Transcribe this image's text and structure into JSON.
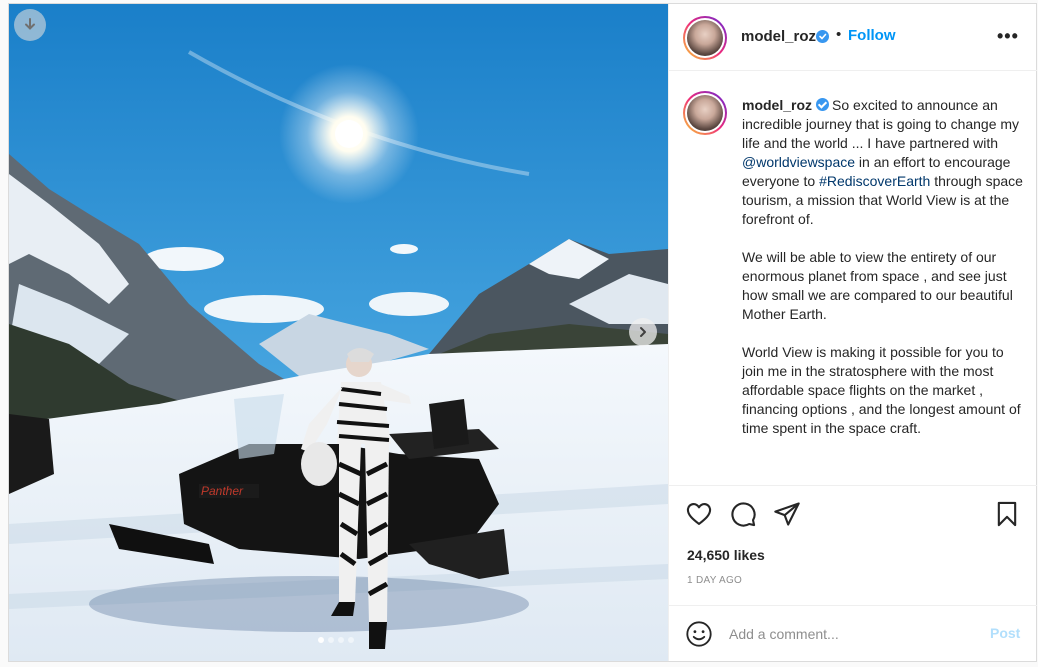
{
  "post": {
    "username": "model_roz",
    "verified": true,
    "follow_label": "Follow",
    "bullet": "•",
    "more_label": "•••",
    "caption": {
      "username": "model_roz",
      "p1_a": "So excited to announce an incredible journey that is going to change my life and the world  ... I have partnered with ",
      "mention": "@worldviewspace",
      "p1_b": " in an effort to encourage everyone to ",
      "hashtag": "#RediscoverEarth",
      "p1_c": " through space tourism, a mission that World View is at the forefront of.",
      "p2": "We will be able to view the entirety of our enormous planet from space , and see just how small we are compared to our beautiful Mother Earth.",
      "p3": "World View is making it possible for you to join me in the stratosphere with the most affordable space flights on the market , financing options , and the longest amount of time spent in the space craft."
    },
    "likes": "24,650 likes",
    "time_ago": "1 DAY AGO",
    "comment_placeholder": "Add a comment...",
    "post_label": "Post",
    "carousel": {
      "count": 4,
      "active": 0
    },
    "image_text": {
      "snowmobile_brand": "Panther"
    },
    "icons": {
      "download": "download-icon",
      "next": "chevron-right-icon",
      "like": "heart-icon",
      "comment": "comment-icon",
      "share": "paper-plane-icon",
      "save": "bookmark-icon",
      "emoji": "smiley-icon"
    },
    "colors": {
      "accent": "#0095f6",
      "post_disabled": "#b2dffc",
      "link": "#00376b",
      "verified": "#3897f0"
    }
  }
}
